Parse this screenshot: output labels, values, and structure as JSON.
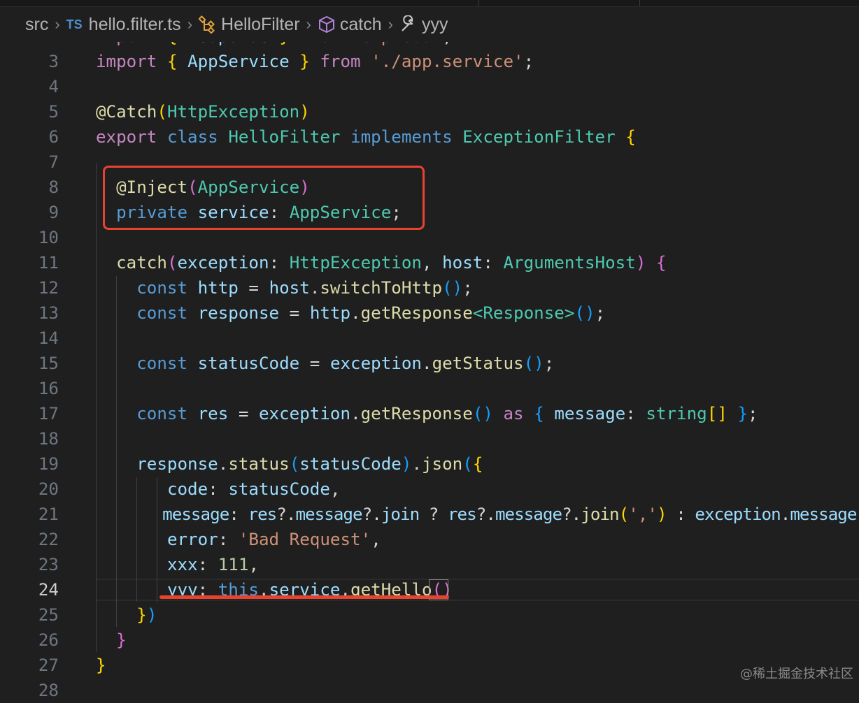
{
  "breadcrumb": {
    "folder": "src",
    "file_badge": "TS",
    "file": "hello.filter.ts",
    "class": "HelloFilter",
    "method": "catch",
    "property": "yyy"
  },
  "current_line": 24,
  "lines": [
    {
      "n": "2",
      "tokens": [
        [
          "k",
          "import"
        ],
        [
          "p",
          " "
        ],
        [
          "b1",
          "{"
        ],
        [
          "p",
          " "
        ],
        [
          "v",
          "Response"
        ],
        [
          "p",
          " "
        ],
        [
          "b1",
          "}"
        ],
        [
          "p",
          " "
        ],
        [
          "k",
          "from"
        ],
        [
          "p",
          " "
        ],
        [
          "str",
          "'express'"
        ],
        [
          "p",
          ";"
        ]
      ]
    },
    {
      "n": "3",
      "tokens": [
        [
          "k",
          "import"
        ],
        [
          "p",
          " "
        ],
        [
          "b1",
          "{"
        ],
        [
          "p",
          " "
        ],
        [
          "v",
          "AppService"
        ],
        [
          "p",
          " "
        ],
        [
          "b1",
          "}"
        ],
        [
          "p",
          " "
        ],
        [
          "k",
          "from"
        ],
        [
          "p",
          " "
        ],
        [
          "str",
          "'./app.service'"
        ],
        [
          "p",
          ";"
        ]
      ]
    },
    {
      "n": "4",
      "tokens": []
    },
    {
      "n": "5",
      "tokens": [
        [
          "f",
          "@Catch"
        ],
        [
          "b1",
          "("
        ],
        [
          "t",
          "HttpException"
        ],
        [
          "b1",
          ")"
        ]
      ]
    },
    {
      "n": "6",
      "tokens": [
        [
          "k",
          "export"
        ],
        [
          "p",
          " "
        ],
        [
          "s",
          "class"
        ],
        [
          "p",
          " "
        ],
        [
          "t",
          "HelloFilter"
        ],
        [
          "p",
          " "
        ],
        [
          "s",
          "implements"
        ],
        [
          "p",
          " "
        ],
        [
          "t",
          "ExceptionFilter"
        ],
        [
          "p",
          " "
        ],
        [
          "b1",
          "{"
        ]
      ]
    },
    {
      "n": "7",
      "tokens": []
    },
    {
      "n": "8",
      "tokens": [
        [
          "p",
          "  "
        ],
        [
          "f",
          "@Inject"
        ],
        [
          "b2",
          "("
        ],
        [
          "t",
          "AppService"
        ],
        [
          "b2",
          ")"
        ]
      ]
    },
    {
      "n": "9",
      "tokens": [
        [
          "p",
          "  "
        ],
        [
          "s",
          "private"
        ],
        [
          "p",
          " "
        ],
        [
          "v",
          "service"
        ],
        [
          "p",
          ": "
        ],
        [
          "t",
          "AppService"
        ],
        [
          "p",
          ";"
        ]
      ]
    },
    {
      "n": "10",
      "tokens": []
    },
    {
      "n": "11",
      "tokens": [
        [
          "p",
          "  "
        ],
        [
          "f",
          "catch"
        ],
        [
          "b2",
          "("
        ],
        [
          "v",
          "exception"
        ],
        [
          "p",
          ": "
        ],
        [
          "t",
          "HttpException"
        ],
        [
          "p",
          ", "
        ],
        [
          "v",
          "host"
        ],
        [
          "p",
          ": "
        ],
        [
          "t",
          "ArgumentsHost"
        ],
        [
          "b2",
          ")"
        ],
        [
          "p",
          " "
        ],
        [
          "b2",
          "{"
        ]
      ]
    },
    {
      "n": "12",
      "tokens": [
        [
          "p",
          "    "
        ],
        [
          "s",
          "const"
        ],
        [
          "p",
          " "
        ],
        [
          "v",
          "http"
        ],
        [
          "p",
          " = "
        ],
        [
          "v",
          "host"
        ],
        [
          "p",
          "."
        ],
        [
          "f",
          "switchToHttp"
        ],
        [
          "b3",
          "()"
        ],
        [
          "p",
          ";"
        ]
      ]
    },
    {
      "n": "13",
      "tokens": [
        [
          "p",
          "    "
        ],
        [
          "s",
          "const"
        ],
        [
          "p",
          " "
        ],
        [
          "v",
          "response"
        ],
        [
          "p",
          " = "
        ],
        [
          "v",
          "http"
        ],
        [
          "p",
          "."
        ],
        [
          "f",
          "getResponse"
        ],
        [
          "t",
          "<Response>"
        ],
        [
          "b3",
          "()"
        ],
        [
          "p",
          ";"
        ]
      ]
    },
    {
      "n": "14",
      "tokens": []
    },
    {
      "n": "15",
      "tokens": [
        [
          "p",
          "    "
        ],
        [
          "s",
          "const"
        ],
        [
          "p",
          " "
        ],
        [
          "v",
          "statusCode"
        ],
        [
          "p",
          " = "
        ],
        [
          "v",
          "exception"
        ],
        [
          "p",
          "."
        ],
        [
          "f",
          "getStatus"
        ],
        [
          "b3",
          "()"
        ],
        [
          "p",
          ";"
        ]
      ]
    },
    {
      "n": "16",
      "tokens": []
    },
    {
      "n": "17",
      "tokens": [
        [
          "p",
          "    "
        ],
        [
          "s",
          "const"
        ],
        [
          "p",
          " "
        ],
        [
          "v",
          "res"
        ],
        [
          "p",
          " = "
        ],
        [
          "v",
          "exception"
        ],
        [
          "p",
          "."
        ],
        [
          "f",
          "getResponse"
        ],
        [
          "b3",
          "()"
        ],
        [
          "p",
          " "
        ],
        [
          "k",
          "as"
        ],
        [
          "p",
          " "
        ],
        [
          "b3",
          "{"
        ],
        [
          "p",
          " "
        ],
        [
          "v",
          "message"
        ],
        [
          "p",
          ": "
        ],
        [
          "t",
          "string"
        ],
        [
          "b1",
          "[]"
        ],
        [
          "p",
          " "
        ],
        [
          "b3",
          "}"
        ],
        [
          "p",
          ";"
        ]
      ]
    },
    {
      "n": "18",
      "tokens": []
    },
    {
      "n": "19",
      "tokens": [
        [
          "p",
          "    "
        ],
        [
          "v",
          "response"
        ],
        [
          "p",
          "."
        ],
        [
          "f",
          "status"
        ],
        [
          "b3",
          "("
        ],
        [
          "v",
          "statusCode"
        ],
        [
          "b3",
          ")"
        ],
        [
          "p",
          "."
        ],
        [
          "f",
          "json"
        ],
        [
          "b3",
          "("
        ],
        [
          "b1",
          "{"
        ]
      ]
    },
    {
      "n": "20",
      "tokens": [
        [
          "p",
          "       "
        ],
        [
          "v",
          "code"
        ],
        [
          "p",
          ": "
        ],
        [
          "v",
          "statusCode"
        ],
        [
          "p",
          ","
        ]
      ]
    },
    {
      "n": "21",
      "tokens": [
        [
          "p",
          "       "
        ],
        [
          "v",
          "message"
        ],
        [
          "p",
          ": "
        ],
        [
          "v",
          "res"
        ],
        [
          "p",
          "?."
        ],
        [
          "v",
          "message"
        ],
        [
          "p",
          "?."
        ],
        [
          "v",
          "join"
        ],
        [
          "p",
          " ? "
        ],
        [
          "v",
          "res"
        ],
        [
          "p",
          "?."
        ],
        [
          "v",
          "message"
        ],
        [
          "p",
          "?."
        ],
        [
          "f",
          "join"
        ],
        [
          "b1",
          "("
        ],
        [
          "str",
          "','"
        ],
        [
          "b1",
          ")"
        ],
        [
          "p",
          " : "
        ],
        [
          "v",
          "exception"
        ],
        [
          "p",
          "."
        ],
        [
          "v",
          "message"
        ]
      ]
    },
    {
      "n": "22",
      "tokens": [
        [
          "p",
          "       "
        ],
        [
          "v",
          "error"
        ],
        [
          "p",
          ": "
        ],
        [
          "str",
          "'Bad Request'"
        ],
        [
          "p",
          ","
        ]
      ]
    },
    {
      "n": "23",
      "tokens": [
        [
          "p",
          "       "
        ],
        [
          "v",
          "xxx"
        ],
        [
          "p",
          ": "
        ],
        [
          "n",
          "111"
        ],
        [
          "p",
          ","
        ]
      ]
    },
    {
      "n": "24",
      "tokens": [
        [
          "p",
          "       "
        ],
        [
          "v",
          "yyy"
        ],
        [
          "p",
          ": "
        ],
        [
          "s",
          "this"
        ],
        [
          "p",
          "."
        ],
        [
          "v",
          "service"
        ],
        [
          "p",
          "."
        ],
        [
          "f",
          "getHello"
        ],
        [
          "b2",
          "()"
        ]
      ]
    },
    {
      "n": "25",
      "tokens": [
        [
          "p",
          "    "
        ],
        [
          "b1",
          "}"
        ],
        [
          "b3",
          ")"
        ]
      ]
    },
    {
      "n": "26",
      "tokens": [
        [
          "p",
          "  "
        ],
        [
          "b2",
          "}"
        ]
      ]
    },
    {
      "n": "27",
      "tokens": [
        [
          "b1",
          "}"
        ]
      ]
    },
    {
      "n": "28",
      "tokens": []
    }
  ],
  "watermark": "@稀土掘金技术社区",
  "colors": {
    "highlight": "#e8432f",
    "background": "#1f1f1f"
  }
}
